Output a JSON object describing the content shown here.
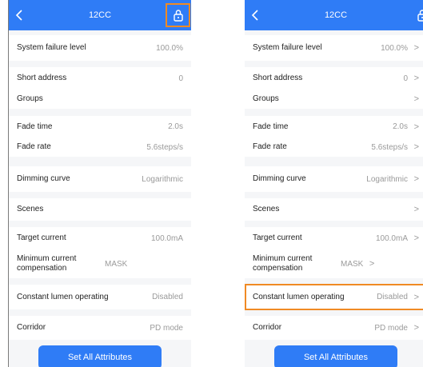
{
  "colors": {
    "header": "#2f7cf6",
    "highlight": "#f08a24",
    "value": "#9a9a9a"
  },
  "header": {
    "title": "12CC"
  },
  "rows": [
    {
      "label": "System failure level",
      "value": "100.0%"
    },
    {
      "label": "Short address",
      "value": "0"
    },
    {
      "label": "Groups",
      "value": ""
    },
    {
      "label": "Fade time",
      "value": "2.0s"
    },
    {
      "label": "Fade rate",
      "value": "5.6steps/s"
    },
    {
      "label": "Dimming curve",
      "value": "Logarithmic"
    },
    {
      "label": "Scenes",
      "value": ""
    },
    {
      "label": "Target current",
      "value": "100.0mA"
    },
    {
      "label": "Minimum current compensation",
      "value": "MASK"
    },
    {
      "label": "Constant lumen operating",
      "value": "Disabled"
    },
    {
      "label": "Corridor",
      "value": "PD mode"
    }
  ],
  "button": {
    "label": "Set All Attributes"
  },
  "icons": {
    "back": "chevron-left-icon",
    "lock": "lock-icon",
    "chevron": "chevron-right-icon"
  },
  "chevron_glyph": ">"
}
